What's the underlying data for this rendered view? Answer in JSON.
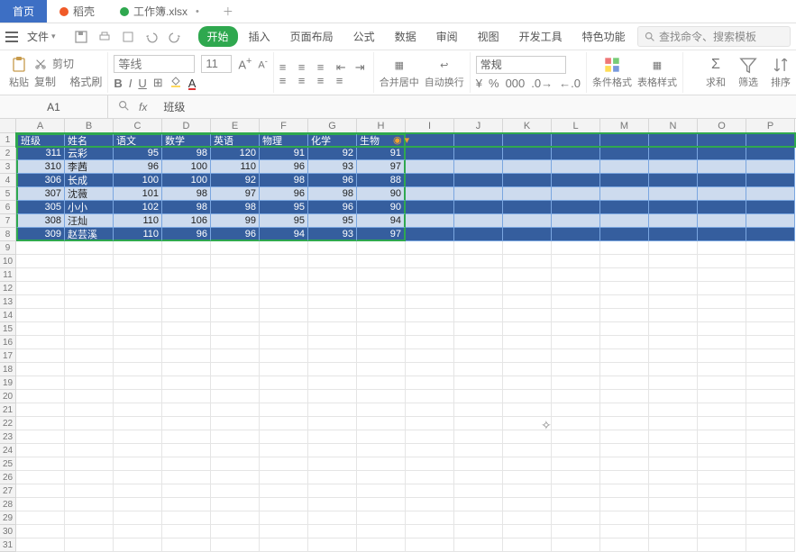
{
  "title_tabs": {
    "home": "首页",
    "t2": "稻壳",
    "t3": "工作簿.xlsx"
  },
  "menu": {
    "file": "文件",
    "tabs": [
      "开始",
      "插入",
      "页面布局",
      "公式",
      "数据",
      "审阅",
      "视图",
      "开发工具",
      "特色功能"
    ],
    "search_placeholder": "查找命令、搜索模板"
  },
  "ribbon": {
    "paste": "粘贴",
    "cut": "剪切",
    "copy": "复制",
    "format_painter": "格式刷",
    "font_name": "等线",
    "font_size": "11",
    "merge": "合并居中",
    "wrap": "自动换行",
    "number_format": "常规",
    "cond": "条件格式",
    "tstyle": "表格样式",
    "sum": "求和",
    "filter": "筛选",
    "sort": "排序"
  },
  "fx": {
    "namebox": "A1",
    "formula": "班级"
  },
  "cols": [
    "A",
    "B",
    "C",
    "D",
    "E",
    "F",
    "G",
    "H",
    "I",
    "J",
    "K",
    "L",
    "M",
    "N",
    "O",
    "P"
  ],
  "row_count": 31,
  "table": {
    "headers": [
      "班级",
      "姓名",
      "语文",
      "数学",
      "英语",
      "物理",
      "化学",
      "生物"
    ],
    "rows": [
      {
        "class": 311,
        "name": "云彩",
        "scores": [
          95,
          98,
          120,
          91,
          92,
          91
        ]
      },
      {
        "class": 310,
        "name": "李茜",
        "scores": [
          96,
          100,
          110,
          96,
          93,
          97
        ]
      },
      {
        "class": 306,
        "name": "长成",
        "scores": [
          100,
          100,
          92,
          98,
          96,
          88
        ]
      },
      {
        "class": 307,
        "name": "沈薇",
        "scores": [
          101,
          98,
          97,
          96,
          98,
          90
        ]
      },
      {
        "class": 305,
        "name": "小小",
        "scores": [
          102,
          98,
          98,
          95,
          96,
          90
        ]
      },
      {
        "class": 308,
        "name": "汪灿",
        "scores": [
          110,
          106,
          99,
          95,
          95,
          94
        ]
      },
      {
        "class": 309,
        "name": "赵芸溪",
        "scores": [
          110,
          96,
          96,
          94,
          93,
          97
        ]
      }
    ]
  }
}
